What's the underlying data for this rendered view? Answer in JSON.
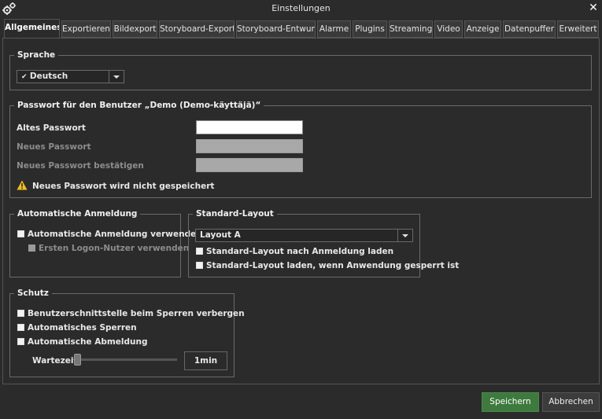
{
  "window": {
    "title": "Einstellungen"
  },
  "tabs": [
    {
      "label": "Allgemeines",
      "active": true
    },
    {
      "label": "Exportieren"
    },
    {
      "label": "Bildexport"
    },
    {
      "label": "Storyboard-Export"
    },
    {
      "label": "Storyboard-Entwurf"
    },
    {
      "label": "Alarme"
    },
    {
      "label": "Plugins"
    },
    {
      "label": "Streaming"
    },
    {
      "label": "Video"
    },
    {
      "label": "Anzeige"
    },
    {
      "label": "Datenpuffer"
    },
    {
      "label": "Erweitert"
    }
  ],
  "language": {
    "title": "Sprache",
    "selected": "Deutsch",
    "check_glyph": "✔"
  },
  "password": {
    "title": "Passwort für den Benutzer „Demo (Demo-käyttäjä)“",
    "old_label": "Altes Passwort",
    "new_label": "Neues Passwort",
    "confirm_label": "Neues Passwort bestätigen",
    "warning": "Neues Passwort wird nicht gespeichert",
    "warning_color": "#f0c020"
  },
  "auto_login": {
    "title": "Automatische Anmeldung",
    "use_auto_login": "Automatische Anmeldung verwenden",
    "use_first_logon_user": "Ersten Logon-Nutzer verwenden"
  },
  "default_layout": {
    "title": "Standard-Layout",
    "selected": "Layout A",
    "load_after_login": "Standard-Layout nach Anmeldung laden",
    "load_when_locked": "Standard-Layout laden, wenn Anwendung gesperrt ist"
  },
  "protection": {
    "title": "Schutz",
    "hide_ui_on_lock": "Benutzerschnittstelle beim Sperren verbergen",
    "auto_lock": "Automatisches Sperren",
    "auto_logout": "Automatische Abmeldung",
    "wait_time_label": "Wartezeit:",
    "wait_time_value": "1min"
  },
  "buttons": {
    "save": "Speichern",
    "cancel": "Abbrechen"
  },
  "colors": {
    "background": "#2b2b2b",
    "primary_button": "#3e7a3e"
  }
}
